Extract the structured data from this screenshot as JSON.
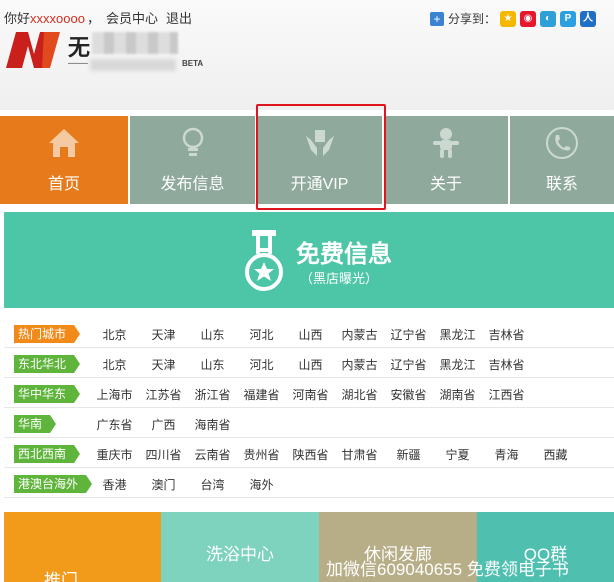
{
  "header": {
    "greeting": "你好",
    "username": "xxxxoooo",
    "member_center": "会员中心",
    "logout": "退出",
    "share_label": "分享到：",
    "share_icons": [
      "qzone-icon",
      "weibo-icon",
      "tencent-weibo-icon",
      "pengyou-icon",
      "renren-icon"
    ]
  },
  "logo": {
    "text": "无",
    "sub": "——",
    "beta": "BETA"
  },
  "nav": {
    "items": [
      {
        "label": "首页",
        "icon": "home-icon"
      },
      {
        "label": "发布信息",
        "icon": "lightbulb-icon"
      },
      {
        "label": "开通VIP",
        "icon": "hands-icon"
      },
      {
        "label": "关于",
        "icon": "gingerbread-icon"
      },
      {
        "label": "联系",
        "icon": "phone-icon"
      }
    ]
  },
  "banner": {
    "title": "免费信息",
    "subtitle": "（黑店曝光）"
  },
  "regions": [
    {
      "tag": "热门城市",
      "color": "orange",
      "cities": [
        "北京",
        "天津",
        "山东",
        "河北",
        "山西",
        "内蒙古",
        "辽宁省",
        "黑龙江",
        "吉林省"
      ]
    },
    {
      "tag": "东北华北",
      "color": "green",
      "cities": [
        "北京",
        "天津",
        "山东",
        "河北",
        "山西",
        "内蒙古",
        "辽宁省",
        "黑龙江",
        "吉林省"
      ]
    },
    {
      "tag": "华中华东",
      "color": "green",
      "cities": [
        "上海市",
        "江苏省",
        "浙江省",
        "福建省",
        "河南省",
        "湖北省",
        "安徽省",
        "湖南省",
        "江西省"
      ]
    },
    {
      "tag": "华南",
      "color": "green",
      "cities": [
        "广东省",
        "广西",
        "海南省"
      ]
    },
    {
      "tag": "西北西南",
      "color": "green",
      "cities": [
        "重庆市",
        "四川省",
        "云南省",
        "贵州省",
        "陕西省",
        "甘肃省",
        "新疆",
        "宁夏",
        "青海",
        "西藏"
      ]
    },
    {
      "tag": "港澳台海外",
      "color": "green",
      "cities": [
        "香港",
        "澳门",
        "台湾",
        "海外"
      ]
    }
  ],
  "tiles": [
    {
      "label": "推门"
    },
    {
      "label": "洗浴中心"
    },
    {
      "label": "休闲发廊"
    },
    {
      "label": "QQ群"
    }
  ],
  "watermark": "加微信609040655 免费领电子书",
  "colors": {
    "orange": "#e77a1a",
    "nav_gray": "#8fa99c",
    "banner_teal": "#4dc5a7",
    "highlight_red": "#e0141c"
  }
}
